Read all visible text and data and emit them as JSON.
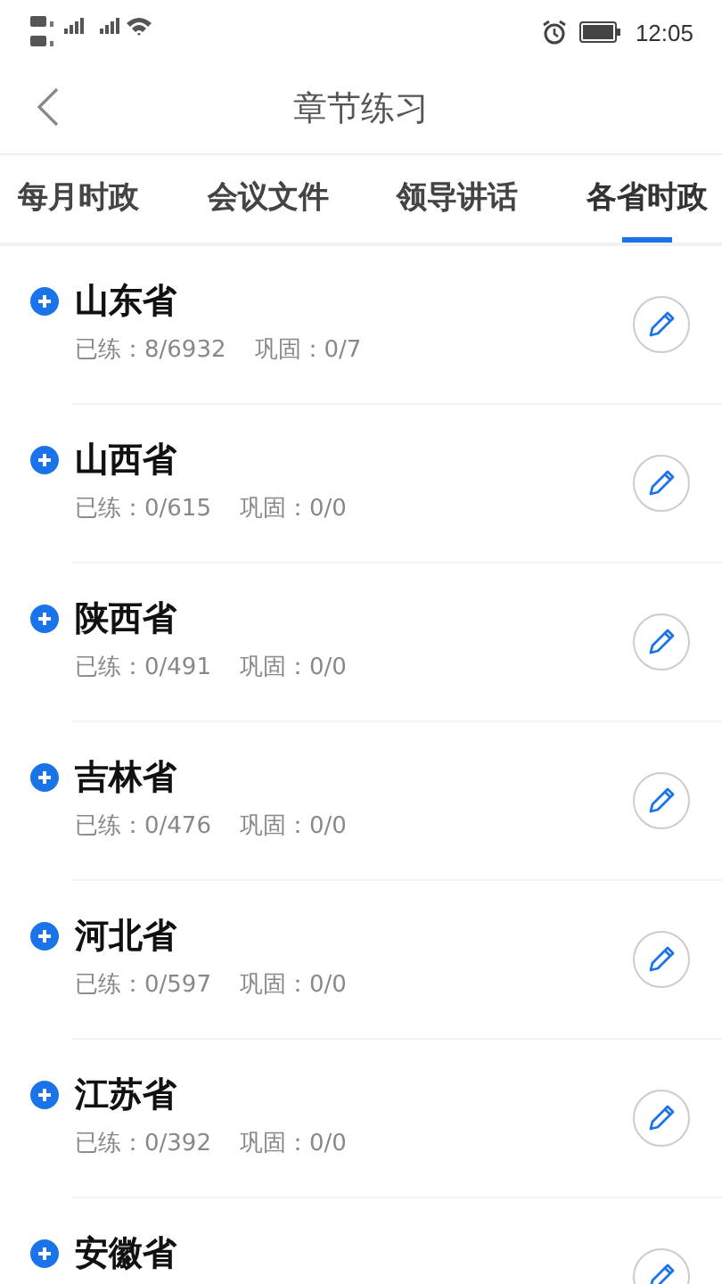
{
  "status_bar": {
    "time": "12:05"
  },
  "header": {
    "title": "章节练习"
  },
  "tabs": [
    {
      "label": "每月时政",
      "selected": false
    },
    {
      "label": "会议文件",
      "selected": false
    },
    {
      "label": "领导讲话",
      "selected": false
    },
    {
      "label": "各省时政",
      "selected": true
    }
  ],
  "chapters": [
    {
      "name": "山东省",
      "practiced": "已练：8/6932",
      "reviewed": "巩固：0/7"
    },
    {
      "name": "山西省",
      "practiced": "已练：0/615",
      "reviewed": "巩固：0/0"
    },
    {
      "name": "陕西省",
      "practiced": "已练：0/491",
      "reviewed": "巩固：0/0"
    },
    {
      "name": "吉林省",
      "practiced": "已练：0/476",
      "reviewed": "巩固：0/0"
    },
    {
      "name": "河北省",
      "practiced": "已练：0/597",
      "reviewed": "巩固：0/0"
    },
    {
      "name": "江苏省",
      "practiced": "已练：0/392",
      "reviewed": "巩固：0/0"
    },
    {
      "name": "安徽省"
    }
  ]
}
